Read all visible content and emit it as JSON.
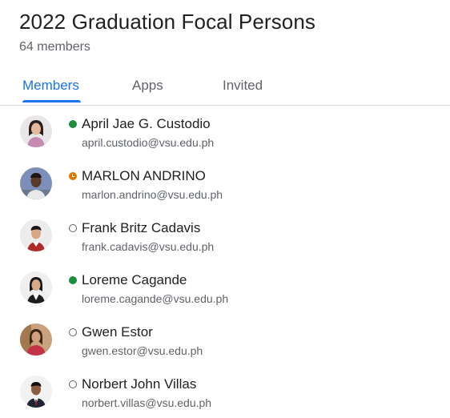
{
  "group": {
    "title": "2022 Graduation Focal Persons",
    "member_count": "64 members"
  },
  "tabs": [
    {
      "label": "Members",
      "active": true
    },
    {
      "label": "Apps",
      "active": false
    },
    {
      "label": "Invited",
      "active": false
    }
  ],
  "members": [
    {
      "name": "April Jae G. Custodio",
      "email": "april.custodio@vsu.edu.ph",
      "status": "online"
    },
    {
      "name": "MARLON ANDRINO",
      "email": "marlon.andrino@vsu.edu.ph",
      "status": "away"
    },
    {
      "name": "Frank Britz Cadavis",
      "email": "frank.cadavis@vsu.edu.ph",
      "status": "offline"
    },
    {
      "name": "Loreme Cagande",
      "email": "loreme.cagande@vsu.edu.ph",
      "status": "online"
    },
    {
      "name": "Gwen Estor",
      "email": "gwen.estor@vsu.edu.ph",
      "status": "offline"
    },
    {
      "name": "Norbert John Villas",
      "email": "norbert.villas@vsu.edu.ph",
      "status": "offline"
    }
  ],
  "colors": {
    "accent": "#1a73e8",
    "online": "#1e8e3e",
    "away": "#e37400",
    "text_primary": "#202124",
    "text_secondary": "#5f6368",
    "divider": "#dadce0"
  }
}
